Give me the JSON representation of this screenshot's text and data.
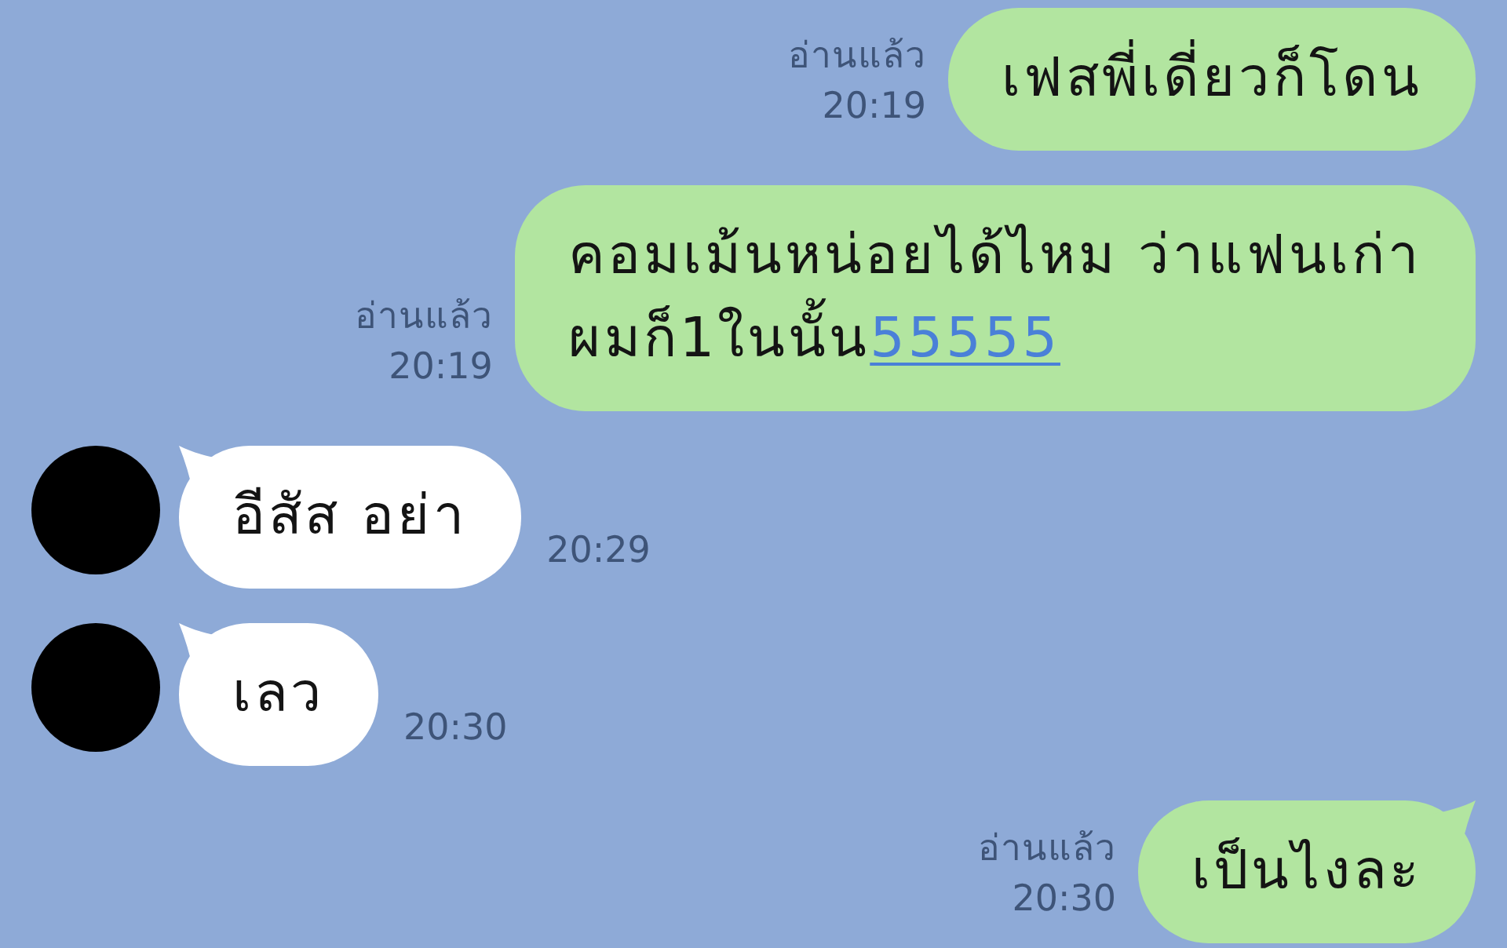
{
  "messages": [
    {
      "kind": "sent",
      "tail": false,
      "lines": [
        [
          {
            "kind": "plain",
            "text": "เฟสพี่เดี่ยวก็โดน"
          }
        ]
      ],
      "read": "อ่านแล้ว",
      "time": "20:19"
    },
    {
      "kind": "sent",
      "tail": false,
      "lines": [
        [
          {
            "kind": "plain",
            "text": "คอมเม้นหน่อยได้ไหม ว่าแฟนเก่า"
          }
        ],
        [
          {
            "kind": "plain",
            "text": "ผมก็1ในนั้น"
          },
          {
            "kind": "link",
            "text": "55555"
          }
        ]
      ],
      "read": "อ่านแล้ว",
      "time": "20:19"
    },
    {
      "kind": "received",
      "tail": true,
      "lines": [
        [
          {
            "kind": "plain",
            "text": "อีสัส อย่า"
          }
        ]
      ],
      "time": "20:29"
    },
    {
      "kind": "received",
      "tail": true,
      "lines": [
        [
          {
            "kind": "plain",
            "text": "เลว"
          }
        ]
      ],
      "time": "20:30"
    },
    {
      "kind": "sent",
      "tail": true,
      "lines": [
        [
          {
            "kind": "plain",
            "text": "เป็นไงละ"
          }
        ]
      ],
      "read": "อ่านแล้ว",
      "time": "20:30"
    }
  ]
}
